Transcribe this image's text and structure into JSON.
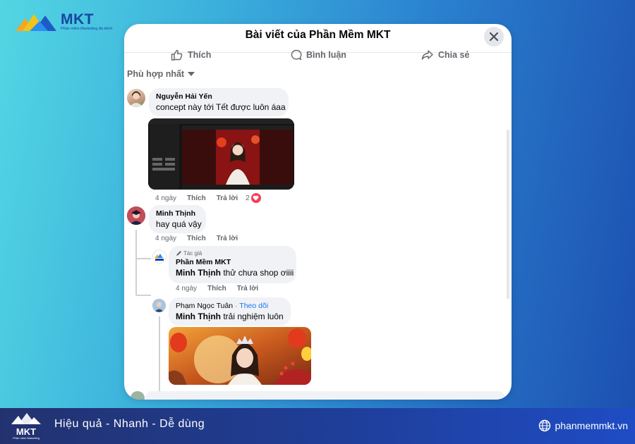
{
  "brand": {
    "name": "MKT",
    "tagline": "Phần mềm Marketing đa kênh",
    "logo_icon": "mountain-logo-icon"
  },
  "modal": {
    "title": "Bài viết của Phần Mềm MKT",
    "close_icon": "close-icon",
    "actions": {
      "like": "Thích",
      "comment": "Bình luận",
      "share": "Chia sẻ"
    },
    "sort_label": "Phù hợp nhất"
  },
  "comments": [
    {
      "name": "Nguyễn Hải Yến",
      "text": "concept này tới Tết được luôn áaa",
      "time": "4 ngày",
      "like": "Thích",
      "reply": "Trả lời",
      "reactions": "2"
    },
    {
      "name": "Minh Thịnh",
      "text": "hay quá vậy",
      "time": "4 ngày",
      "like": "Thích",
      "reply": "Trả lời"
    }
  ],
  "replies": [
    {
      "badge": "Tác giả",
      "name": "Phần Mềm MKT",
      "mention": "Minh Thịnh",
      "text": " thử chưa shop ơiiii",
      "time": "4 ngày",
      "like": "Thích",
      "reply": "Trả lời"
    },
    {
      "name": "Phạm Ngọc Tuân",
      "follow": "· Theo dõi",
      "mention": "Minh Thịnh",
      "text": " trải nghiệm luôn"
    }
  ],
  "footer": {
    "slogan": "Hiệu quả - Nhanh  - Dễ dùng",
    "website": "phanmemmkt.vn",
    "logo_name": "MKT",
    "logo_tagline": "Phần mềm Marketing"
  },
  "colors": {
    "accent_blue": "#1877f2",
    "heart_red": "#f33e58",
    "brand_blue": "#1746a2"
  }
}
